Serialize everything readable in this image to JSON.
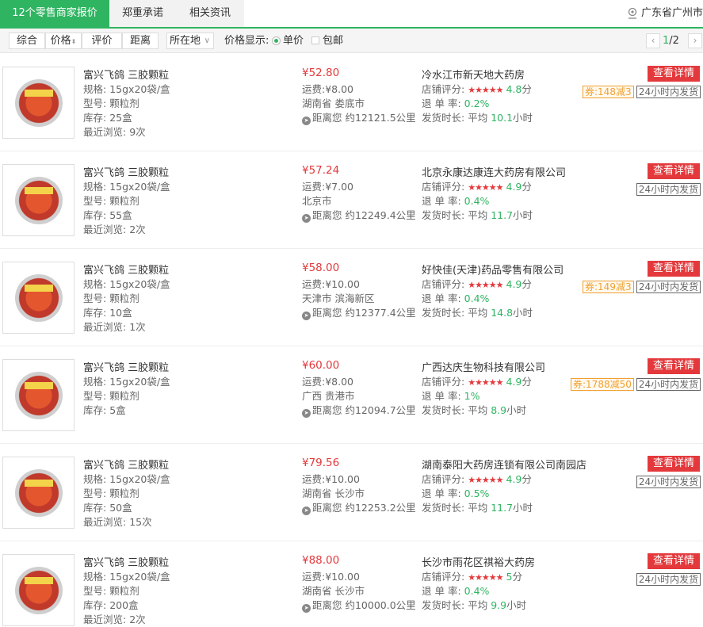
{
  "tabs": [
    {
      "label": "12个零售商家报价"
    },
    {
      "label": "郑重承诺"
    },
    {
      "label": "相关资讯"
    }
  ],
  "location": "广东省广州市",
  "sort": {
    "comprehensive": "综合",
    "price": "价格",
    "rating": "评价",
    "distance": "距离",
    "region_select": "所在地",
    "price_display_label": "价格显示:",
    "unit_price": "单价",
    "free_shipping": "包邮",
    "page_current": "1",
    "page_total": "/2"
  },
  "labels": {
    "spec": "规格:",
    "type": "型号:",
    "stock": "库存:",
    "recent": "最近浏览:",
    "freight": "运费:",
    "distance": "距离您 约",
    "rating": "店铺评分:",
    "refund": "退 单 率:",
    "ship_time": "发货时长:",
    "avg": "平均",
    "hours": "小时",
    "detail_button": "查看详情",
    "ship_tag": "24小时内发货"
  },
  "products": [
    {
      "name": "富兴飞鸽 三胶颗粒",
      "spec": "15gx20袋/盒",
      "type": "颗粒剂",
      "stock": "25盒",
      "recent": "9次",
      "price": "¥52.80",
      "freight": "¥8.00",
      "region": "湖南省 娄底市",
      "distance": "12121.5公里",
      "store": "冷水江市新天地大药房",
      "stars": "★★★★★",
      "score": "4.8",
      "score_unit": "分",
      "refund": "0.2%",
      "ship_hours": "10.1",
      "coupon": "券:148减3"
    },
    {
      "name": "富兴飞鸽 三胶颗粒",
      "spec": "15gx20袋/盒",
      "type": "颗粒剂",
      "stock": "55盒",
      "recent": "2次",
      "price": "¥57.24",
      "freight": "¥7.00",
      "region": "北京市",
      "distance": "12249.4公里",
      "store": "北京永康达康连大药房有限公司",
      "stars": "★★★★★",
      "score": "4.9",
      "score_unit": "分",
      "refund": "0.4%",
      "ship_hours": "11.7",
      "coupon": ""
    },
    {
      "name": "富兴飞鸽 三胶颗粒",
      "spec": "15gx20袋/盒",
      "type": "颗粒剂",
      "stock": "10盒",
      "recent": "1次",
      "price": "¥58.00",
      "freight": "¥10.00",
      "region": "天津市 滨海新区",
      "distance": "12377.4公里",
      "store": "好快佳(天津)药品零售有限公司",
      "stars": "★★★★★",
      "score": "4.9",
      "score_unit": "分",
      "refund": "0.4%",
      "ship_hours": "14.8",
      "coupon": "券:149减3"
    },
    {
      "name": "富兴飞鸽 三胶颗粒",
      "spec": "15gx20袋/盒",
      "type": "颗粒剂",
      "stock": "5盒",
      "recent": "",
      "price": "¥60.00",
      "freight": "¥8.00",
      "region": "广西 贵港市",
      "distance": "12094.7公里",
      "store": "广西达庆生物科技有限公司",
      "stars": "★★★★★",
      "score": "4.9",
      "score_unit": "分",
      "refund": "1%",
      "ship_hours": "8.9",
      "coupon": "券:1788减50"
    },
    {
      "name": "富兴飞鸽 三胶颗粒",
      "spec": "15gx20袋/盒",
      "type": "颗粒剂",
      "stock": "50盒",
      "recent": "15次",
      "price": "¥79.56",
      "freight": "¥10.00",
      "region": "湖南省 长沙市",
      "distance": "12253.2公里",
      "store": "湖南泰阳大药房连锁有限公司南园店",
      "stars": "★★★★★",
      "score": "4.9",
      "score_unit": "分",
      "refund": "0.5%",
      "ship_hours": "11.7",
      "coupon": ""
    },
    {
      "name": "富兴飞鸽 三胶颗粒",
      "spec": "15gx20袋/盒",
      "type": "颗粒剂",
      "stock": "200盒",
      "recent": "2次",
      "price": "¥88.00",
      "freight": "¥10.00",
      "region": "湖南省 长沙市",
      "distance": "10000.0公里",
      "store": "长沙市雨花区祺裕大药房",
      "stars": "★★★★★",
      "score": "5",
      "score_unit": "分",
      "refund": "0.4%",
      "ship_hours": "9.9",
      "coupon": ""
    }
  ],
  "colors": {
    "accent": "#2fb461",
    "price": "#e4393c",
    "coupon": "#f0a030"
  },
  "icons": {
    "location": "location-pin-icon",
    "distance": "navigation-icon",
    "prev": "chevron-left-icon",
    "next": "chevron-right-icon"
  }
}
